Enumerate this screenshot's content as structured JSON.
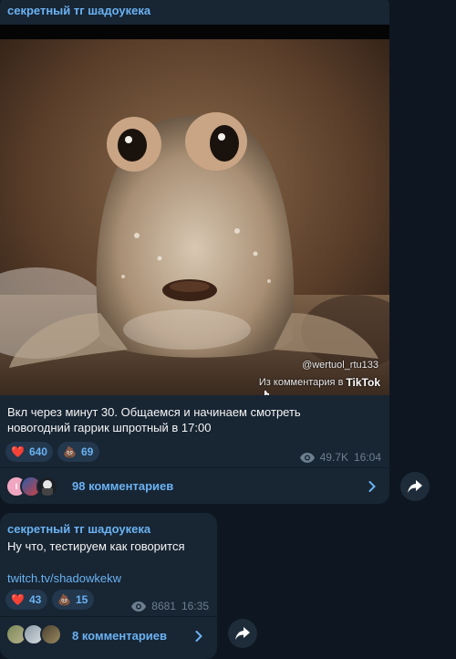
{
  "post1": {
    "channel": "секретный тг шадоукека",
    "watermark_user": "@wertuol_rtu133",
    "watermark_source": "Из комментария в",
    "watermark_brand": "TikTok",
    "text_line1": "Вкл через минут 30. Общаемся и начинаем смотреть",
    "text_line2": "новогодний гаррик шпротный в 17:00",
    "reactions": [
      {
        "emoji": "❤️",
        "count": "640"
      },
      {
        "emoji": "💩",
        "count": "69"
      }
    ],
    "views": "49.7K",
    "time": "16:04",
    "comments_label": "98 комментариев",
    "avatar_letter": "I"
  },
  "post2": {
    "channel": "секретный тг шадоукека",
    "text": "Ну что, тестируем как говорится",
    "link": "twitch.tv/shadowkekw",
    "reactions": [
      {
        "emoji": "❤️",
        "count": "43"
      },
      {
        "emoji": "💩",
        "count": "15"
      }
    ],
    "views": "8681",
    "time": "16:35",
    "comments_label": "8 комментариев"
  },
  "colors": {
    "background": "#0e1621",
    "bubble": "#182533",
    "accent": "#6ab2f2",
    "meta": "#6d7f8f"
  }
}
